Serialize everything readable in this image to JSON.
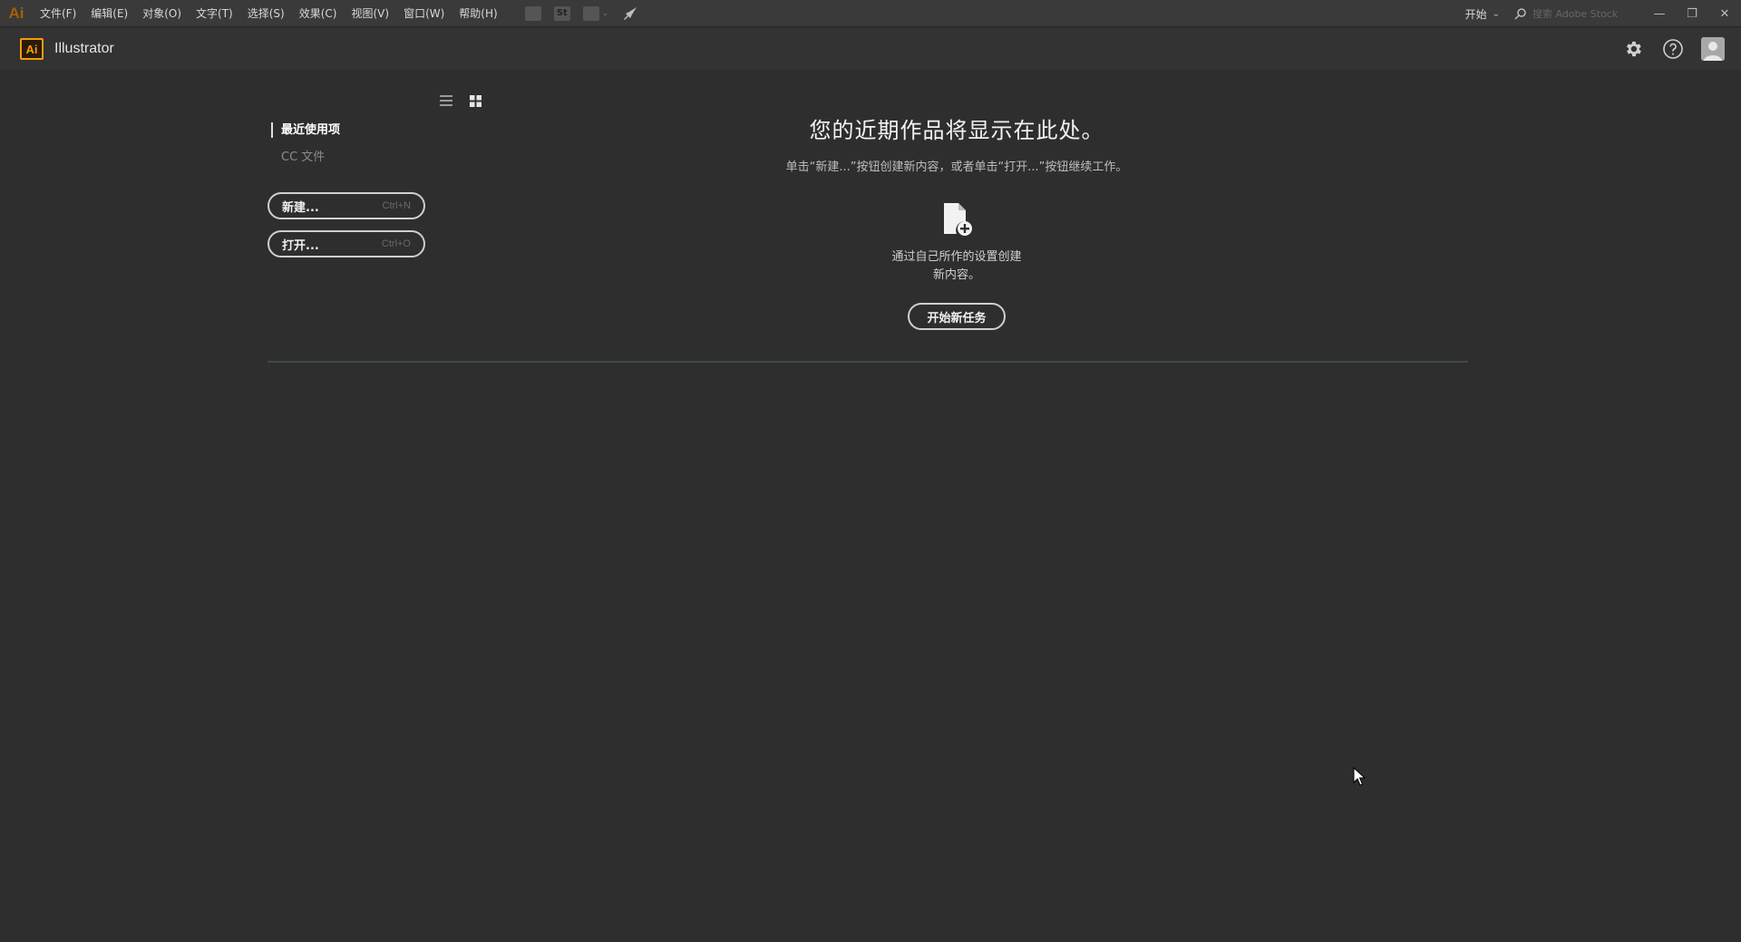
{
  "menubar": {
    "app_mark": "Ai",
    "items": [
      {
        "label": "文件(F)"
      },
      {
        "label": "编辑(E)"
      },
      {
        "label": "对象(O)"
      },
      {
        "label": "文字(T)"
      },
      {
        "label": "选择(S)"
      },
      {
        "label": "效果(C)"
      },
      {
        "label": "视图(V)"
      },
      {
        "label": "窗口(W)"
      },
      {
        "label": "帮助(H)"
      }
    ],
    "tool_icons": [
      "bridge-icon",
      "stock-icon",
      "arrange-documents-icon",
      "gpu-performance-icon"
    ],
    "stock_label": "St",
    "workspace_label": "开始",
    "search_placeholder": "搜索 Adobe Stock"
  },
  "header": {
    "logo_text": "Ai",
    "app_name": "Illustrator",
    "icons": [
      "gear-icon",
      "help-icon",
      "user-avatar-icon"
    ]
  },
  "sidebar": {
    "nav": [
      {
        "label": "最近使用项",
        "active": true
      },
      {
        "label": "CC 文件",
        "active": false
      }
    ],
    "buttons": [
      {
        "label": "新建...",
        "shortcut": "Ctrl+N"
      },
      {
        "label": "打开...",
        "shortcut": "Ctrl+O"
      }
    ]
  },
  "main": {
    "title": "您的近期作品将显示在此处。",
    "subtitle": "单击“新建...”按钮创建新内容，或者单击“打开...”按钮继续工作。",
    "desc_line1": "通过自己所作的设置创建",
    "desc_line2": "新内容。",
    "start_button": "开始新任务"
  },
  "colors": {
    "background": "#2e2e2e",
    "menubar": "#3a3a3a",
    "brand_orange": "#f29c11"
  }
}
